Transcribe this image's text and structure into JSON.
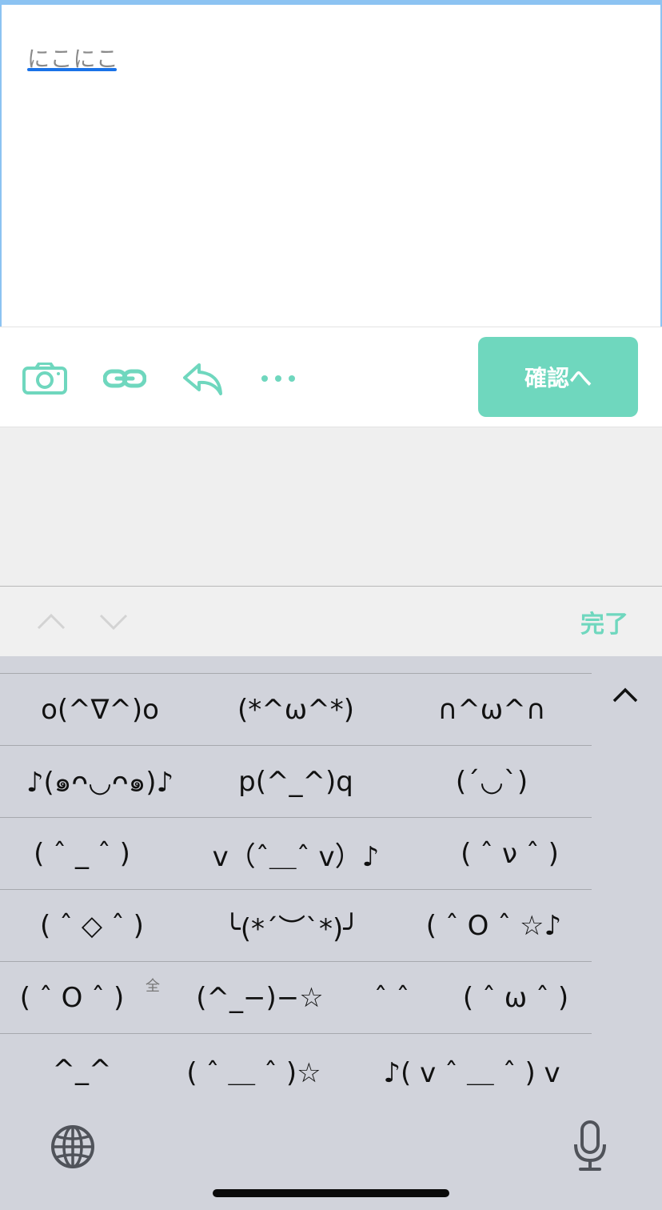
{
  "editor": {
    "composing_text": "にこにこ"
  },
  "toolbar": {
    "icons": [
      "camera-icon",
      "link-icon",
      "reply-icon",
      "more-icon"
    ],
    "confirm_label": "確認へ",
    "accent_color": "#6fd7be"
  },
  "accessory": {
    "prev_icon": "chevron-up-icon",
    "next_icon": "chevron-down-icon",
    "done_label": "完了"
  },
  "keyboard": {
    "rows": [
      [
        "o(^∇^)o",
        "(*^ω^*)",
        "∩^ω^∩"
      ],
      [
        "♪(๑ᴖ◡ᴖ๑)♪",
        "p(^_^)q",
        "(ˊ◡ˋ)"
      ],
      [
        "( ˆ _ ˆ )",
        "v（ˆ＿ˆ v）♪",
        "( ˆ ν ˆ )"
      ],
      [
        "( ˆ ◇ ˆ )",
        "╰(*´︶`*)╯",
        "( ˆ O ˆ ☆♪"
      ],
      [
        "( ˆ O ˆ )",
        "(^_−)−☆",
        "ˆ ˆ",
        "( ˆ ω ˆ )"
      ],
      [
        "^_^",
        "( ˆ ＿ ˆ )☆",
        "♪( v ˆ ＿ ˆ ) v"
      ]
    ],
    "full_width_tag": "全",
    "collapse_icon": "chevron-up-icon",
    "globe_icon": "globe-icon",
    "mic_icon": "microphone-icon"
  }
}
